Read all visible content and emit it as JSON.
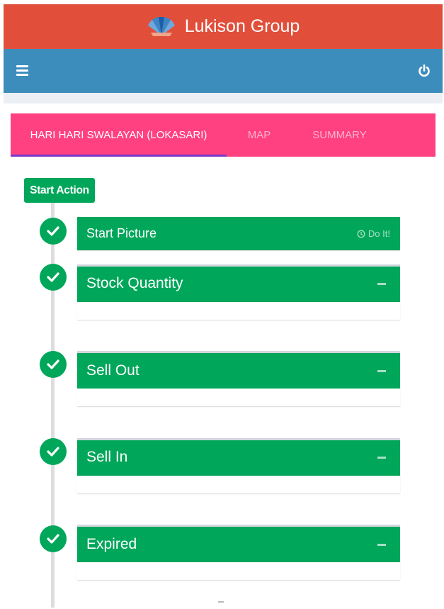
{
  "app": {
    "brand_name": "Lukison Group",
    "logo_icon": "peacock-fan-logo"
  },
  "navbar": {
    "menu_icon": "hamburger-icon",
    "power_icon": "power-icon"
  },
  "tabs": [
    {
      "label": "HARI HARI SWALAYAN (LOKASARI)",
      "active": true
    },
    {
      "label": "MAP",
      "active": false
    },
    {
      "label": "SUMMARY",
      "active": false
    }
  ],
  "timeline": {
    "start_label": "Start Action",
    "start_picture": {
      "title": "Start Picture",
      "action_label": "Do It!",
      "action_icon": "clock-icon"
    },
    "sections": [
      {
        "title": "Stock Quantity"
      },
      {
        "title": "Sell Out"
      },
      {
        "title": "Sell In"
      },
      {
        "title": "Expired"
      }
    ]
  },
  "colors": {
    "brand_bar": "#e14f3b",
    "navbar": "#3c8dbc",
    "tabs_bg": "#ff4081",
    "tab_indicator": "#7b39c9",
    "success": "#00a65a",
    "timeline_line": "#dddddd"
  }
}
